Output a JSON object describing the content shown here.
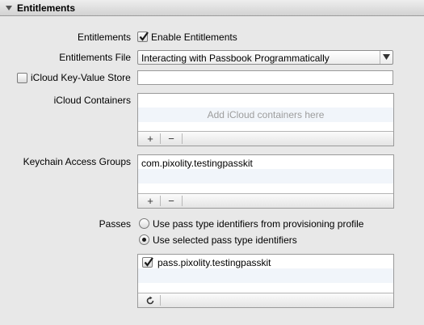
{
  "section": {
    "title": "Entitlements"
  },
  "entitlements": {
    "label": "Entitlements",
    "checkbox_label": "Enable Entitlements",
    "checked": true
  },
  "entitlements_file": {
    "label": "Entitlements File",
    "value": "Interacting with Passbook Programmatically"
  },
  "icloud_kv": {
    "label": "iCloud Key-Value Store",
    "checked": false,
    "value": ""
  },
  "icloud_containers": {
    "label": "iCloud Containers",
    "placeholder": "Add iCloud containers here",
    "add": "+",
    "remove": "−"
  },
  "keychain": {
    "label": "Keychain Access Groups",
    "items": [
      "com.pixolity.testingpasskit"
    ],
    "add": "+",
    "remove": "−"
  },
  "passes": {
    "label": "Passes",
    "options": [
      {
        "label": "Use pass type identifiers from provisioning profile",
        "selected": false
      },
      {
        "label": "Use selected pass type identifiers",
        "selected": true
      }
    ],
    "items": [
      {
        "label": "pass.pixolity.testingpasskit",
        "checked": true
      }
    ],
    "refresh": "↻"
  },
  "colors": {
    "panel_bg": "#e8e8e8",
    "placeholder": "#9d9d9d",
    "alt_row": "#f1f5fa"
  },
  "icons": [
    "disclosure-triangle-icon",
    "checkmark-icon",
    "chevron-down-icon",
    "refresh-icon"
  ]
}
